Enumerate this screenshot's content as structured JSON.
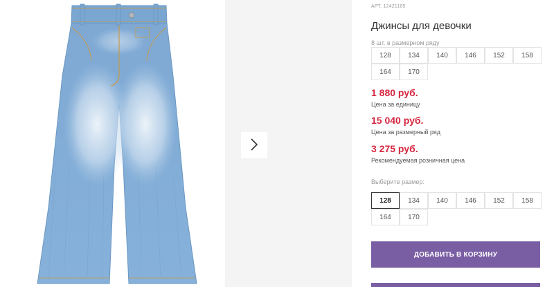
{
  "product": {
    "article": "АРТ. 12421185",
    "title": "Джинсы для девочки",
    "set_note": "8 шт. в размерном ряду"
  },
  "size_set": [
    "128",
    "134",
    "140",
    "146",
    "152",
    "158",
    "164",
    "170"
  ],
  "prices": {
    "unit_price": "1 880 руб.",
    "unit_label": "Цена за единицу",
    "set_price": "15 040 руб.",
    "set_label": "Цена за размерный ряд",
    "retail_price": "3 275 руб.",
    "retail_label": "Рекомендуемая розничная цена"
  },
  "size_select": {
    "label": "Выберите размер:",
    "options": [
      "128",
      "134",
      "140",
      "146",
      "152",
      "158",
      "164",
      "170"
    ],
    "selected": "128"
  },
  "actions": {
    "add_to_cart": "ДОБАВИТЬ В КОРЗИНУ"
  },
  "icons": {
    "next_arrow": "chevron-right-icon"
  },
  "colors": {
    "price": "#d5263f",
    "button": "#7a5ea4",
    "denim": "#8fb6dc"
  }
}
